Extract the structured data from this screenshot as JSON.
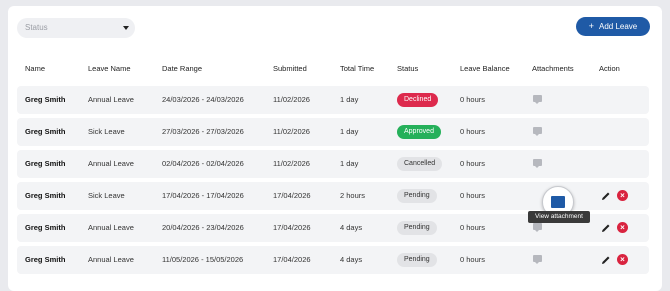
{
  "filters": {
    "status_placeholder": "Status"
  },
  "toolbar": {
    "add_leave_label": "Add Leave"
  },
  "table": {
    "headers": [
      "Name",
      "Leave Name",
      "Date Range",
      "Submitted",
      "Total Time",
      "Status",
      "Leave Balance",
      "Attachments",
      "Action"
    ],
    "rows": [
      {
        "name": "Greg Smith",
        "leave_name": "Annual Leave",
        "date_range": "24/03/2026 - 24/03/2026",
        "submitted": "11/02/2026",
        "total_time": "1 day",
        "status": "Declined",
        "balance": "0 hours"
      },
      {
        "name": "Greg Smith",
        "leave_name": "Sick Leave",
        "date_range": "27/03/2026 - 27/03/2026",
        "submitted": "11/02/2026",
        "total_time": "1 day",
        "status": "Approved",
        "balance": "0 hours"
      },
      {
        "name": "Greg Smith",
        "leave_name": "Annual Leave",
        "date_range": "02/04/2026 - 02/04/2026",
        "submitted": "11/02/2026",
        "total_time": "1 day",
        "status": "Cancelled",
        "balance": "0 hours"
      },
      {
        "name": "Greg Smith",
        "leave_name": "Sick Leave",
        "date_range": "17/04/2026 - 17/04/2026",
        "submitted": "17/04/2026",
        "total_time": "2 hours",
        "status": "Pending",
        "balance": "0 hours"
      },
      {
        "name": "Greg Smith",
        "leave_name": "Annual Leave",
        "date_range": "20/04/2026 - 23/04/2026",
        "submitted": "17/04/2026",
        "total_time": "4 days",
        "status": "Pending",
        "balance": "0 hours"
      },
      {
        "name": "Greg Smith",
        "leave_name": "Annual Leave",
        "date_range": "11/05/2026 - 15/05/2026",
        "submitted": "17/04/2026",
        "total_time": "4 days",
        "status": "Pending",
        "balance": "0 hours"
      }
    ]
  },
  "tooltip": {
    "text": "View attachment"
  },
  "colors": {
    "primary": "#1f5aa6",
    "declined": "#dd2a4d",
    "approved": "#25b05a",
    "neutral_badge": "#e2e3e6"
  }
}
